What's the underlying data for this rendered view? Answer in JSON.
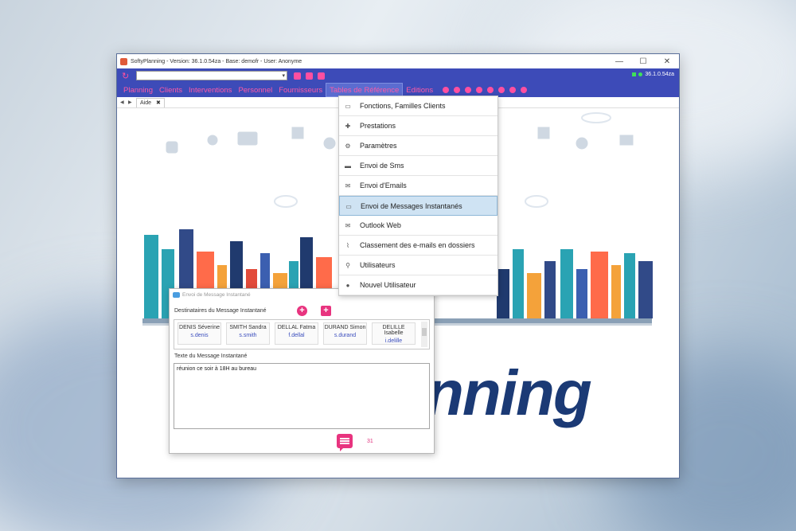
{
  "window": {
    "title": "SoftyPlanning - Version: 36.1.0.54za - Base: demofr - User: Anonyme",
    "controls": {
      "minimize": "—",
      "maximize": "☐",
      "close": "✕"
    },
    "version": "36.1.0.54za"
  },
  "toolbar": {
    "combo_value": "",
    "combo_arrow": "▾",
    "refresh_icon": "↻"
  },
  "menu": {
    "items": [
      "Planning",
      "Clients",
      "Interventions",
      "Personnel",
      "Fournisseurs",
      "Tables de Référence",
      "Editions"
    ],
    "active_index": 5
  },
  "tabs": {
    "current": "Aide",
    "close": "✖"
  },
  "dropdown": {
    "items": [
      {
        "label": "Fonctions, Familles Clients",
        "icon": "window-icon",
        "glyph": "▭"
      },
      {
        "label": "Prestations",
        "icon": "puzzle-icon",
        "glyph": "✚"
      },
      {
        "label": "Paramètres",
        "icon": "gear-icon",
        "glyph": "⚙"
      },
      {
        "label": "Envoi de Sms",
        "icon": "sms-icon",
        "glyph": "▬"
      },
      {
        "label": "Envoi d'Emails",
        "icon": "mail-icon",
        "glyph": "✉"
      },
      {
        "label": "Envoi de Messages Instantanés",
        "icon": "message-icon",
        "glyph": "▭"
      },
      {
        "label": "Outlook Web",
        "icon": "outlook-icon",
        "glyph": "✉"
      },
      {
        "label": "Classement des e-mails en dossiers",
        "icon": "paperclip-icon",
        "glyph": "⌇"
      },
      {
        "label": "Utilisateurs",
        "icon": "search-icon",
        "glyph": "⚲"
      },
      {
        "label": "Nouvel Utilisateur",
        "icon": "user-icon",
        "glyph": "●"
      }
    ],
    "highlighted_index": 5
  },
  "logo": {
    "text": "nning"
  },
  "dialog": {
    "title": "Envoi de Message Instantané",
    "recipients_label": "Destinataires du Message Instantané",
    "recipients": [
      {
        "name": "DENIS Séverine",
        "login": "s.denis"
      },
      {
        "name": "SMITH Sandra",
        "login": "s.smith"
      },
      {
        "name": "DELLAL Fatma",
        "login": "f.dellal"
      },
      {
        "name": "DURAND Simon",
        "login": "s.durand"
      },
      {
        "name": "DELILLE Isabelle",
        "login": "i.delille"
      }
    ],
    "message_label": "Texte du Message Instantané",
    "message": "réunion ce soir à 18H au bureau",
    "char_count": "31"
  },
  "colors": {
    "accent": "#3d4bb8",
    "pink": "#e8347f",
    "logo": "#1b3a75"
  }
}
